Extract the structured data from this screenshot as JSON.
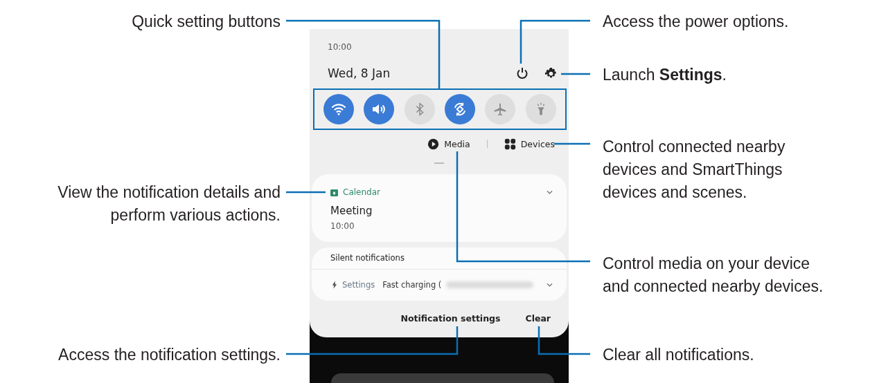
{
  "phone": {
    "time": "10:00",
    "date": "Wed, 8 Jan",
    "quick_settings": [
      {
        "kind": "wifi",
        "on": true
      },
      {
        "kind": "sound",
        "on": true
      },
      {
        "kind": "bluetooth",
        "on": false
      },
      {
        "kind": "rotate",
        "on": true
      },
      {
        "kind": "airplane",
        "on": false
      },
      {
        "kind": "flashlight",
        "on": false
      }
    ],
    "media_button": "Media",
    "devices_button": "Devices",
    "notifications": [
      {
        "app": "Calendar",
        "title": "Meeting",
        "time": "10:00"
      }
    ],
    "silent": {
      "heading": "Silent notifications",
      "items": [
        {
          "app": "Settings",
          "text": "Fast charging ("
        }
      ]
    },
    "notification_settings_button": "Notification settings",
    "clear_button": "Clear"
  },
  "callouts": [
    {
      "lines": [
        "Quick setting buttons"
      ]
    },
    {
      "lines": [
        "Access the power options."
      ]
    },
    {
      "lines": [
        "Launch **Settings**."
      ]
    },
    {
      "lines": [
        "Control connected nearby",
        "devices and SmartThings",
        "devices and scenes."
      ]
    },
    {
      "lines": [
        "View the notification details and",
        "perform various actions."
      ]
    },
    {
      "lines": [
        "Control media on your device",
        "and connected nearby devices."
      ]
    },
    {
      "lines": [
        "Access the notification settings."
      ]
    },
    {
      "lines": [
        "Clear all notifications."
      ]
    }
  ]
}
